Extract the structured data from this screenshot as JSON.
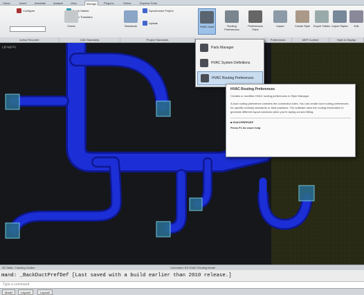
{
  "tabs": [
    "Home",
    "Insert",
    "Annotate",
    "Analyze",
    "View",
    "Manage",
    "Plug-ins",
    "Online",
    "Express Tools"
  ],
  "active_tab": "Manage",
  "ribbon": {
    "small_buttons": [
      "Configure",
      "Batch Marker",
      "Layer Translator",
      "Synchronize Project",
      "Update"
    ],
    "big_buttons": [
      "Check",
      "Standards",
      "Synchronize Check",
      "HVAC Duct",
      "Routing Preferences",
      "Preferences Pane",
      "Import",
      "Create Style",
      "Export Tables",
      "Import Styles",
      "Edit"
    ],
    "panel_labels": [
      "Action Recorder",
      "CAD Standards",
      "Project Standards",
      "Preferences",
      "MEP Content",
      "Style & Display"
    ],
    "combo_value": ""
  },
  "dropdown": {
    "items": [
      "Parts Manager",
      "HVAC System Definitions",
      "HVAC Routing Preferences"
    ],
    "selected": 2
  },
  "tooltip": {
    "title": "HVAC Routing Preferences",
    "lines": [
      "Creates or modifies HVAC routing preferences in Style Manager.",
      "A duct routing preference contains the connection rules. You can create duct routing preferences for specific industry standards or best practices. The software uses the routing information to generate different layout solutions when you're laying out and fitting."
    ],
    "command": "HVACPREFDEF",
    "help": "Press F1 for more help"
  },
  "canvas": {
    "viewport_label": "[-][Top][2D]"
  },
  "status": {
    "left": "3D Static: Tracking Guides",
    "mid": "Command: DS HVAC Routing Model"
  },
  "command_history": "mand: _BackDuctPrefDef [Last saved with a build earlier than 2010 release.]",
  "command_input": "Type a command",
  "layout_tabs": [
    "Model",
    "Layout1",
    "Layout2"
  ],
  "colors": {
    "duct": "#1c2fd6",
    "duct_edge": "#3a50ff",
    "fitting": "#4fa7c9",
    "canvas": "#15171a"
  }
}
